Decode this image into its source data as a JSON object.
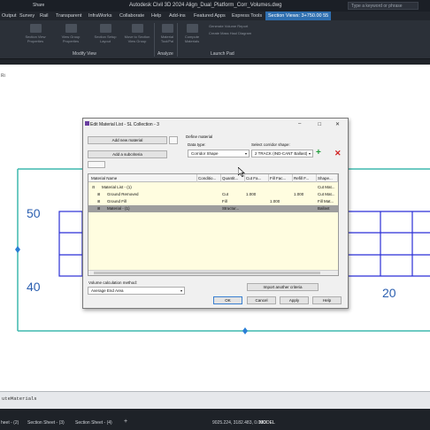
{
  "window": {
    "title": "Autodesk Civil 3D 2024   Align_Dual_Platform_Corr_Volumes.dwg",
    "share_label": "Share",
    "search_placeholder": "Type a keyword or phrase"
  },
  "menu": {
    "items": [
      "Output",
      "Survey",
      "Rail",
      "Transparent",
      "InfraWorks",
      "Collaborate",
      "Help",
      "Add-ins",
      "Featured Apps",
      "Express Tools"
    ],
    "active": "Section Views: 3+750.00 55"
  },
  "ribbon": {
    "buttons": [
      "Section View Properties",
      "View Group Properties",
      "Section Setup Layout",
      "Move to Section View Group",
      "Material Tool/Pal",
      "Compute Materials",
      "Generate Volume Report",
      "Create Mass Haul Diagram"
    ],
    "panels": [
      "Modify View",
      "Analyze",
      "Launch Pad"
    ]
  },
  "drawing": {
    "axis_labels": [
      "50",
      "40"
    ],
    "station_label": "20",
    "corner_mark": "Ri"
  },
  "dialog": {
    "title": "Edit Material List - SL Collection - 3",
    "add_material_label": "Add new material",
    "add_subcriteria_label": "Add a subcriteria",
    "define_material_label": "Define material",
    "data_type_label": "Data type:",
    "data_type_value": "Corridor Shape",
    "select_shape_label": "Select corridor shape:",
    "shape_value": "2 TRACK (IND-CANT Ballast)",
    "columns": [
      "Material Name",
      "Conditio...",
      "Quantit...",
      "Cut Fa...",
      "Fill Fac...",
      "Refill F...",
      "Shape...",
      "C"
    ],
    "rows": [
      {
        "name": "Material List - (1)",
        "cond": "",
        "qty": "",
        "cut": "",
        "fill": "",
        "refill": "",
        "shape": "Cut Mat..."
      },
      {
        "name": "Ground Removed",
        "cond": "",
        "qty": "Cut",
        "cut": "1.000",
        "fill": "",
        "refill": "1.000",
        "shape": "Cut Mat..."
      },
      {
        "name": "Ground Fill",
        "cond": "",
        "qty": "Fill",
        "cut": "",
        "fill": "1.000",
        "refill": "",
        "shape": "Fill Mat..."
      },
      {
        "name": "Material - (1)",
        "cond": "",
        "qty": "Structur...",
        "cut": "",
        "fill": "",
        "refill": "",
        "shape": "Ballast"
      }
    ],
    "volume_method_label": "Volume calculation method:",
    "volume_method_value": "Average End Area",
    "import_label": "Import another criteria",
    "ok_label": "OK",
    "cancel_label": "Cancel",
    "apply_label": "Apply",
    "help_label": "Help"
  },
  "command": {
    "text": "uteMaterials"
  },
  "layout_tabs": [
    "heet - (2)",
    "Section Sheet - (3)",
    "Section Sheet - (4)"
  ],
  "status": {
    "coords": "9025.224, 3182.483, 0.000",
    "model": "MODEL"
  },
  "colors": {
    "grid_blue": "#2b2fd6",
    "frame_cyan": "#3fb9ad",
    "selected_row": "#9e9e9e",
    "grid_background": "#fffde0"
  }
}
